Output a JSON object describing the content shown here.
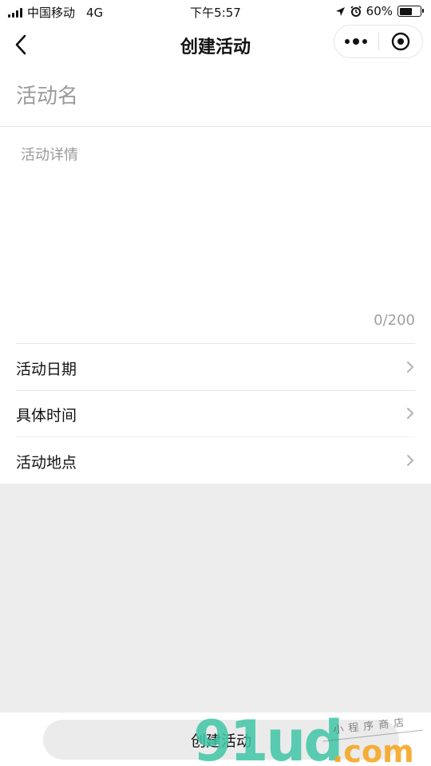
{
  "status_bar": {
    "carrier": "中国移动",
    "network": "4G",
    "time": "下午5:57",
    "battery": "60%",
    "battery_level": 0.6,
    "icons": [
      "signal-icon",
      "location-arrow-icon",
      "alarm-icon",
      "battery-icon"
    ]
  },
  "nav": {
    "title": "创建活动",
    "back_icon": "chevron-left-icon",
    "more_icon": "more-dots-icon",
    "close_icon": "target-circle-icon"
  },
  "form": {
    "name_placeholder": "活动名",
    "detail_placeholder": "活动详情",
    "char_counter": "0/200",
    "rows": [
      {
        "label": "活动日期",
        "icon": "chevron-right-icon"
      },
      {
        "label": "具体时间",
        "icon": "chevron-right-icon"
      },
      {
        "label": "活动地点",
        "icon": "chevron-right-icon"
      }
    ]
  },
  "bottom": {
    "submit_label": "创建活动"
  },
  "watermark": {
    "logo": "91ud",
    "domain": ".com",
    "tagline": "小程序商店"
  },
  "colors": {
    "background": "#ededed",
    "surface": "#ffffff",
    "placeholder": "#9a9a9a",
    "button": "#ebebeb",
    "watermark_green": "#3fc6a6",
    "watermark_orange": "#f5a623"
  }
}
